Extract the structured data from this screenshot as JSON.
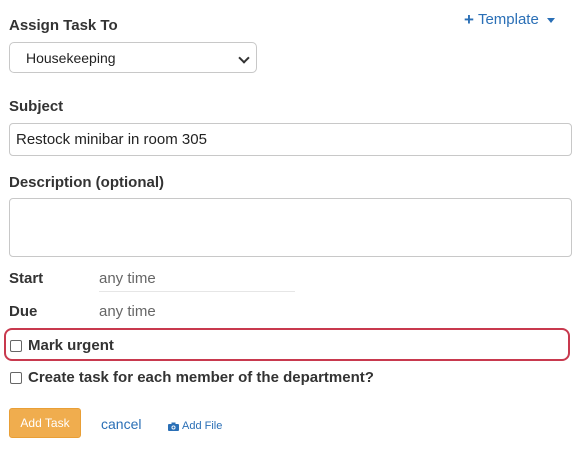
{
  "assign": {
    "label": "Assign Task To",
    "selected": "Housekeeping"
  },
  "template": {
    "label": "Template"
  },
  "subject": {
    "label": "Subject",
    "value": "Restock minibar in room 305"
  },
  "description": {
    "label": "Description (optional)",
    "value": ""
  },
  "start": {
    "label": "Start",
    "value": "any time"
  },
  "due": {
    "label": "Due",
    "value": "any time"
  },
  "options": {
    "mark_urgent": "Mark urgent",
    "each_member": "Create task for each member of the department?"
  },
  "actions": {
    "add_task": "Add Task",
    "cancel": "cancel",
    "add_file": "Add File"
  },
  "colors": {
    "accent_link": "#2a6fb6",
    "primary_button": "#f0ad4e",
    "highlight_border": "#c8394e"
  }
}
